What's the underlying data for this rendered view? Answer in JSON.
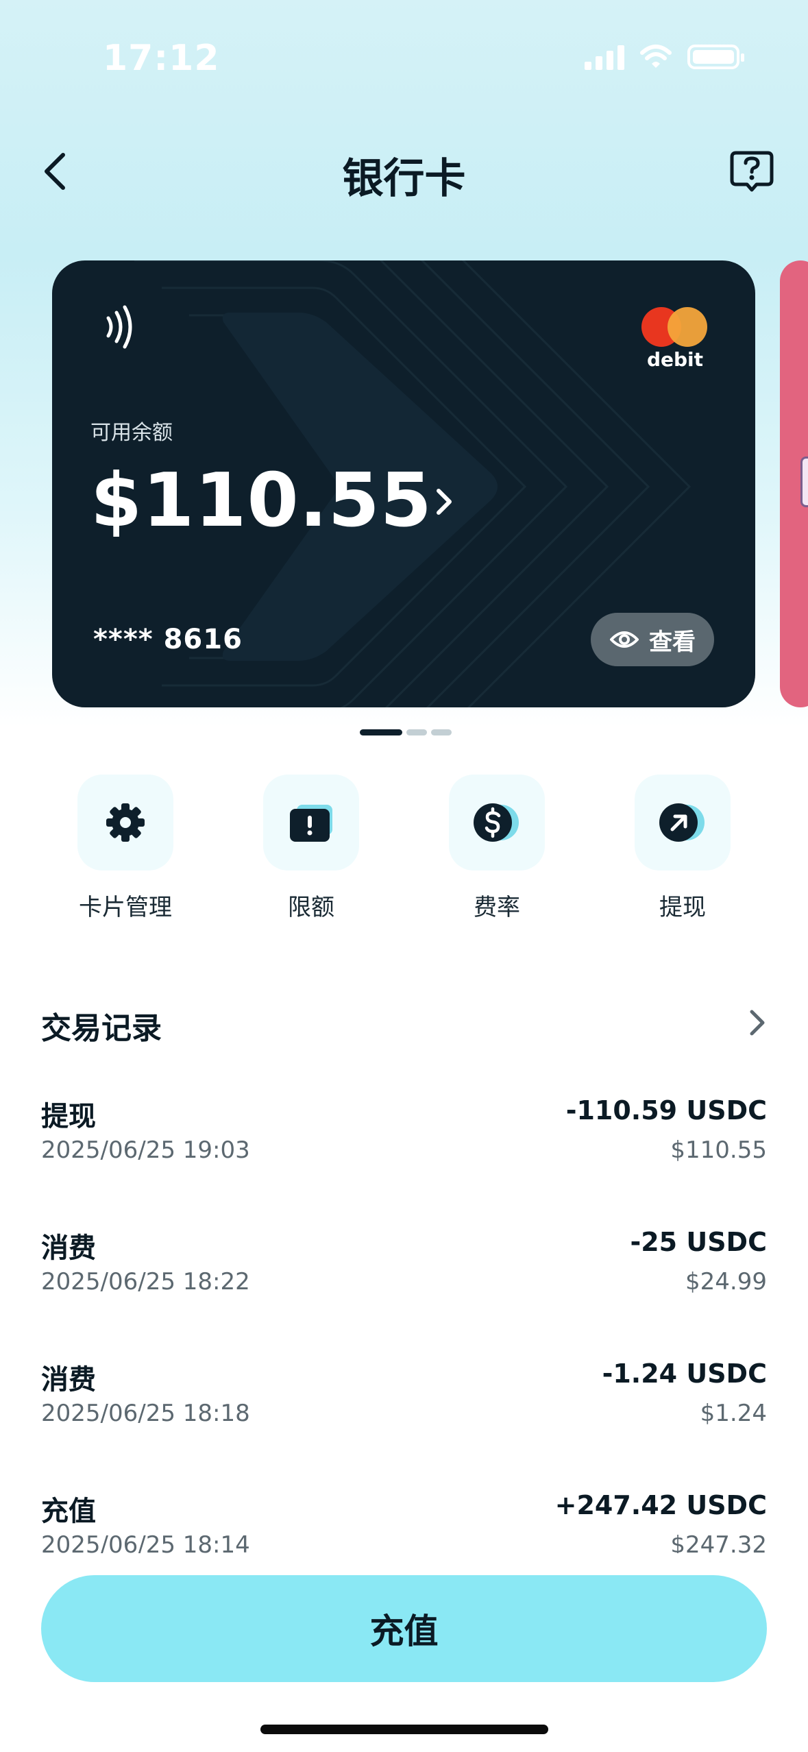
{
  "status_bar": {
    "time": "17:12"
  },
  "nav": {
    "title": "银行卡"
  },
  "card": {
    "brand_text": "debit",
    "balance_label": "可用余额",
    "balance": "$110.55",
    "card_number": "**** 8616",
    "view_label": "查看",
    "page_count": 3,
    "active_page": 1
  },
  "actions": [
    {
      "label": "卡片管理",
      "icon": "gear-icon"
    },
    {
      "label": "限额",
      "icon": "limit-icon"
    },
    {
      "label": "费率",
      "icon": "dollar-icon"
    },
    {
      "label": "提现",
      "icon": "withdraw-arrow-icon"
    }
  ],
  "transactions": {
    "title": "交易记录",
    "items": [
      {
        "type": "提现",
        "time": "2025/06/25 19:03",
        "amount": "-110.59 USDC",
        "usd": "$110.55"
      },
      {
        "type": "消费",
        "time": "2025/06/25 18:22",
        "amount": "-25 USDC",
        "usd": "$24.99"
      },
      {
        "type": "消费",
        "time": "2025/06/25 18:18",
        "amount": "-1.24 USDC",
        "usd": "$1.24"
      },
      {
        "type": "充值",
        "time": "2025/06/25 18:14",
        "amount": "+247.42 USDC",
        "usd": "$247.32"
      }
    ]
  },
  "bottom": {
    "recharge_label": "充值"
  },
  "colors": {
    "card_bg": "#0e1f2b",
    "accent": "#8ae8f4",
    "mastercard_red": "#e8361f",
    "mastercard_yellow": "#f4a53b"
  }
}
